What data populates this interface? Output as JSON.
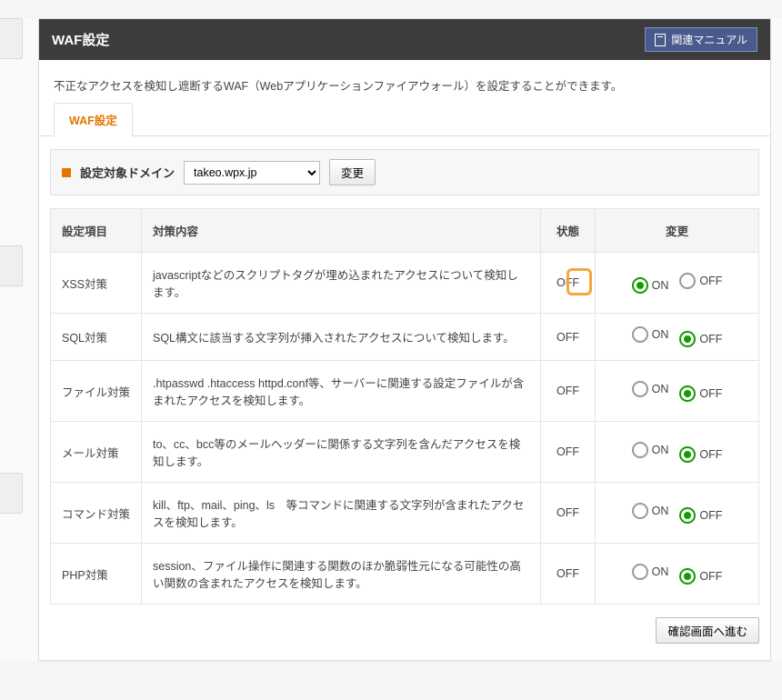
{
  "header": {
    "title": "WAF設定",
    "manual_label": "関連マニュアル"
  },
  "description": "不正なアクセスを検知し遮断するWAF（Webアプリケーションファイアウォール）を設定することができます。",
  "tab": {
    "label": "WAF設定"
  },
  "domain_bar": {
    "label": "設定対象ドメイン",
    "selected": "takeo.wpx.jp",
    "change_btn": "変更"
  },
  "table": {
    "headers": {
      "item": "設定項目",
      "content": "対策内容",
      "state": "状態",
      "change": "変更"
    },
    "on": "ON",
    "off": "OFF",
    "rows": [
      {
        "name": "XSS対策",
        "content": "javascriptなどのスクリプトタグが埋め込まれたアクセスについて検知します。",
        "state": "OFF",
        "selected": "ON",
        "highlight": true
      },
      {
        "name": "SQL対策",
        "content": "SQL構文に該当する文字列が挿入されたアクセスについて検知します。",
        "state": "OFF",
        "selected": "OFF"
      },
      {
        "name": "ファイル対策",
        "content": ".htpasswd .htaccess httpd.conf等、サーバーに関連する設定ファイルが含まれたアクセスを検知します。",
        "state": "OFF",
        "selected": "OFF"
      },
      {
        "name": "メール対策",
        "content": "to、cc、bcc等のメールヘッダーに関係する文字列を含んだアクセスを検知します。",
        "state": "OFF",
        "selected": "OFF"
      },
      {
        "name": "コマンド対策",
        "content": "kill、ftp、mail、ping、ls　等コマンドに関連する文字列が含まれたアクセスを検知します。",
        "state": "OFF",
        "selected": "OFF"
      },
      {
        "name": "PHP対策",
        "content": "session、ファイル操作に関連する関数のほか脆弱性元になる可能性の高い関数の含まれたアクセスを検知します。",
        "state": "OFF",
        "selected": "OFF"
      }
    ]
  },
  "footer": {
    "confirm_btn": "確認画面へ進む"
  }
}
